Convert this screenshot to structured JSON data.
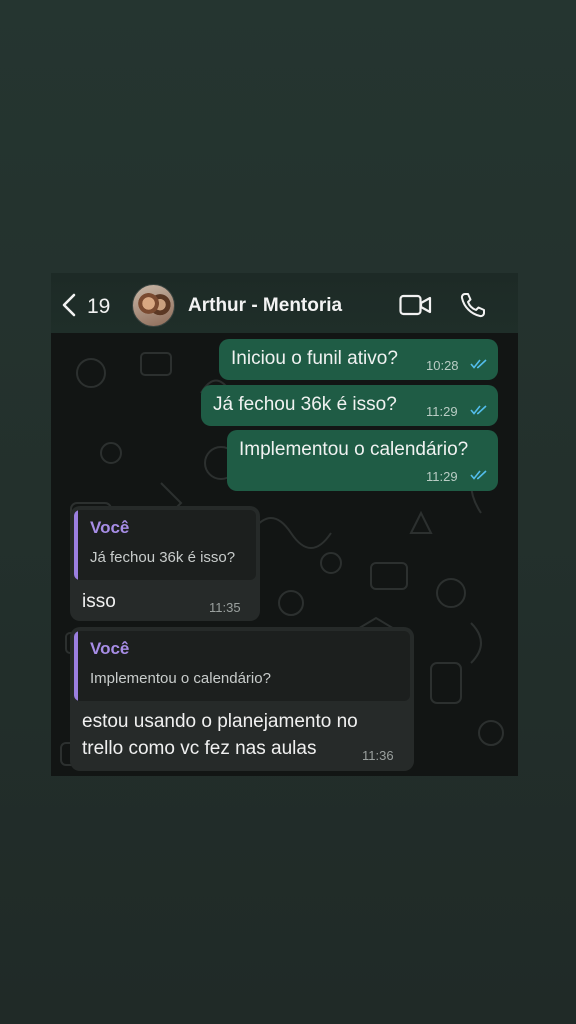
{
  "header": {
    "back_count": "19",
    "contact_name": "Arthur - Mentoria"
  },
  "messages": [
    {
      "direction": "out",
      "text": "Iniciou o funil ativo?",
      "time": "10:28",
      "status": "read"
    },
    {
      "direction": "out",
      "text": "Já fechou 36k é isso?",
      "time": "11:29",
      "status": "read"
    },
    {
      "direction": "out",
      "text": "Implementou o calendário?",
      "time": "11:29",
      "status": "read"
    },
    {
      "direction": "in",
      "quote_author": "Você",
      "quote_text": "Já fechou 36k é isso?",
      "text": "isso",
      "time": "11:35"
    },
    {
      "direction": "in",
      "quote_author": "Você",
      "quote_text": "Implementou o calendário?",
      "text_line1": "estou usando o planejamento no",
      "text_line2": "trello como vc fez nas aulas",
      "time": "11:36"
    }
  ],
  "colors": {
    "outgoing_bubble": "#1f5c45",
    "incoming_bubble": "#262a29",
    "quote_accent": "#9b7fe0",
    "read_ticks": "#53bdeb"
  }
}
